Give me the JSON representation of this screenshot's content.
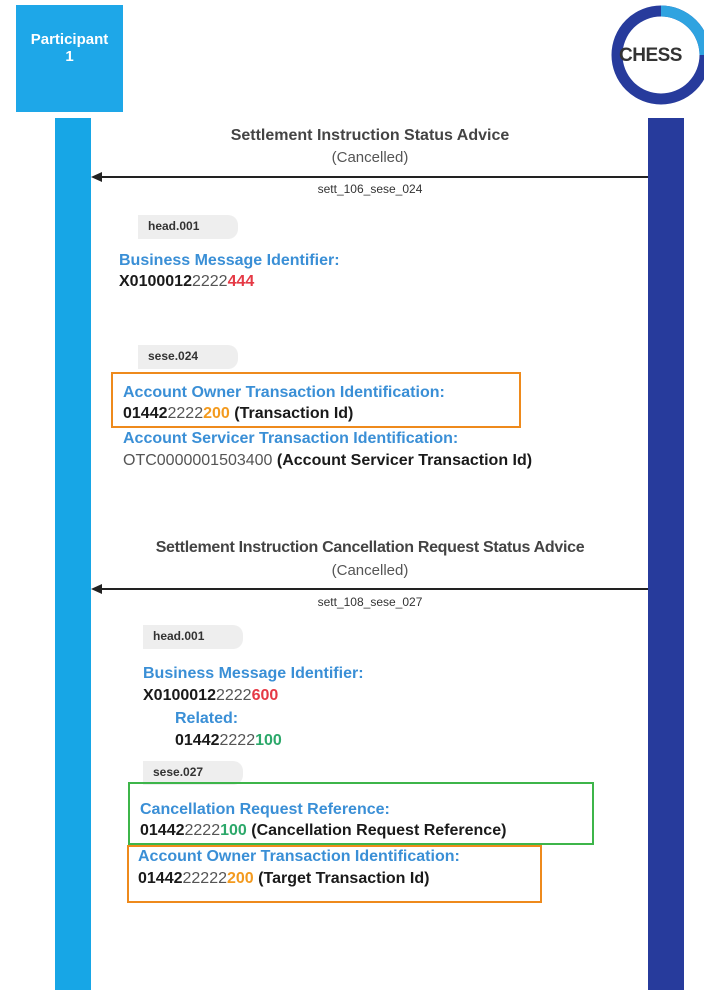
{
  "participant": {
    "label": "Participant 1"
  },
  "chess": {
    "label": "CHESS"
  },
  "message1": {
    "title": "Settlement Instruction Status Advice",
    "status": "(Cancelled)",
    "message_id": "sett_106_sese_024",
    "head_tag": "head.001",
    "bmi_label": "Business Message Identifier:",
    "bmi_value": {
      "bold": "X0100012",
      "plain": "2222",
      "highlight": "444"
    },
    "body_tag": "sese.024",
    "aoti_label": "Account Owner Transaction Identification:",
    "aoti_value": {
      "bold": "01442",
      "plain": "2222",
      "highlight": "200",
      "suffix": " (Transaction Id)"
    },
    "asti_label": "Account Servicer Transaction Identification:",
    "asti_value": {
      "plain": "OTC0000001503400",
      "suffix": " (Account Servicer Transaction Id)"
    }
  },
  "message2": {
    "title": "Settlement Instruction Cancellation Request Status Advice",
    "status": "(Cancelled)",
    "message_id": "sett_108_sese_027",
    "head_tag": "head.001",
    "bmi_label": "Business Message Identifier:",
    "bmi_value": {
      "bold": "X0100012",
      "plain": "2222",
      "highlight": "600"
    },
    "related_label": "Related:",
    "related_value": {
      "bold": "01442",
      "plain": "2222",
      "highlight": "100"
    },
    "body_tag": "sese.027",
    "crr_label": "Cancellation Request Reference:",
    "crr_value": {
      "bold": "01442",
      "plain": "2222",
      "highlight": "100",
      "suffix": " (Cancellation Request Reference)"
    },
    "aoti_label": "Account Owner Transaction Identification:",
    "aoti_value": {
      "bold": "01442",
      "plain": "22222",
      "highlight": "200",
      "suffix": " (Target Transaction Id)"
    }
  },
  "colors": {
    "participant": "#1ea7e8",
    "chess": "#273b9c",
    "label_blue": "#3a8fd6",
    "highlight_orange": "#f39a1e",
    "highlight_red": "#e53945",
    "highlight_green": "#2ca86a"
  }
}
